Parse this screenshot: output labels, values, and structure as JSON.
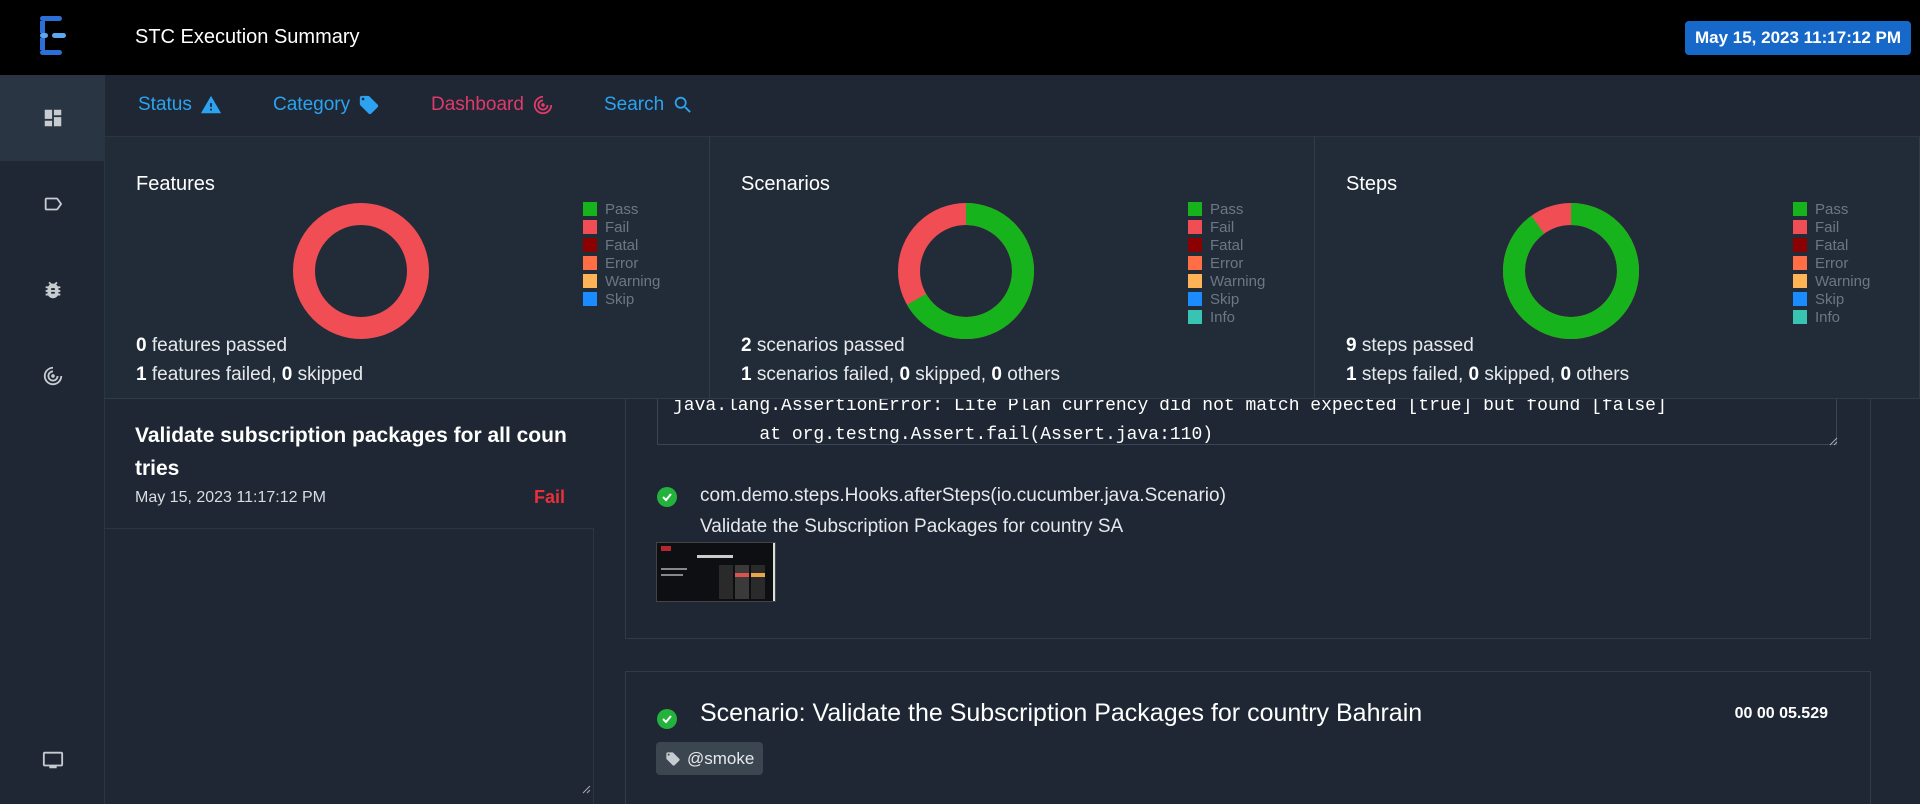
{
  "header": {
    "title": "STC Execution Summary",
    "date_badge": "May 15, 2023 11:17:12 PM"
  },
  "sidebar": {
    "items": [
      {
        "icon": "dashboard-icon",
        "active": true
      },
      {
        "icon": "tag-icon",
        "active": false
      },
      {
        "icon": "bug-icon",
        "active": false
      },
      {
        "icon": "target-icon",
        "active": false
      },
      {
        "icon": "monitor-icon",
        "active": false
      }
    ]
  },
  "nav": {
    "status": {
      "label": "Status",
      "color": "#2ba3f0",
      "icon": "warning-icon"
    },
    "category": {
      "label": "Category",
      "color": "#2ba3f0",
      "icon": "tag-icon"
    },
    "dashboard": {
      "label": "Dashboard",
      "color": "#e0396b",
      "icon": "target-icon"
    },
    "search": {
      "label": "Search",
      "color": "#2ba3f0",
      "icon": "search-icon"
    }
  },
  "colors": {
    "pass": "#17b31d",
    "fail": "#f04e54",
    "fatal": "#8b0000",
    "error": "#ff6e45",
    "warning": "#ffb357",
    "skip": "#1a8cff",
    "info": "#38c3b3"
  },
  "cards": {
    "features": {
      "title": "Features",
      "legend": [
        "Pass",
        "Fail",
        "Fatal",
        "Error",
        "Warning",
        "Skip"
      ],
      "passed_count": "0",
      "passed_text": " features passed",
      "failed_count": "1",
      "failed_text": " features failed, ",
      "skipped_count": "0",
      "skipped_text": " skipped",
      "chart_pass": 0,
      "chart_fail": 1
    },
    "scenarios": {
      "title": "Scenarios",
      "legend": [
        "Pass",
        "Fail",
        "Fatal",
        "Error",
        "Warning",
        "Skip",
        "Info"
      ],
      "passed_count": "2",
      "passed_text": " scenarios passed",
      "failed_count": "1",
      "failed_text": " scenarios failed, ",
      "skipped_count": "0",
      "skipped_text": " skipped, ",
      "others_count": "0",
      "others_text": " others",
      "chart_pass": 2,
      "chart_fail": 1
    },
    "steps": {
      "title": "Steps",
      "legend": [
        "Pass",
        "Fail",
        "Fatal",
        "Error",
        "Warning",
        "Skip",
        "Info"
      ],
      "passed_count": "9",
      "passed_text": " steps passed",
      "failed_count": "1",
      "failed_text": " steps failed, ",
      "skipped_count": "0",
      "skipped_text": " skipped, ",
      "others_count": "0",
      "others_text": " others",
      "chart_pass": 9,
      "chart_fail": 1
    }
  },
  "test_list": {
    "items": [
      {
        "name": "Validate subscription packages for all countries",
        "date": "May 15, 2023 11:17:12 PM",
        "status": "Fail"
      }
    ]
  },
  "detail": {
    "error_line1": "java.lang.AssertionError: Lite Plan currency did not match expected [true] but found [false]",
    "error_line2": "        at org.testng.Assert.fail(Assert.java:110)",
    "hook_name": "com.demo.steps.Hooks.afterSteps(io.cucumber.java.Scenario)",
    "hook_desc": "Validate the Subscription Packages for country SA",
    "scenario_title": "Scenario: Validate the Subscription Packages for country Bahrain",
    "scenario_duration": "00 00 05.529",
    "scenario_tag": "@smoke"
  }
}
